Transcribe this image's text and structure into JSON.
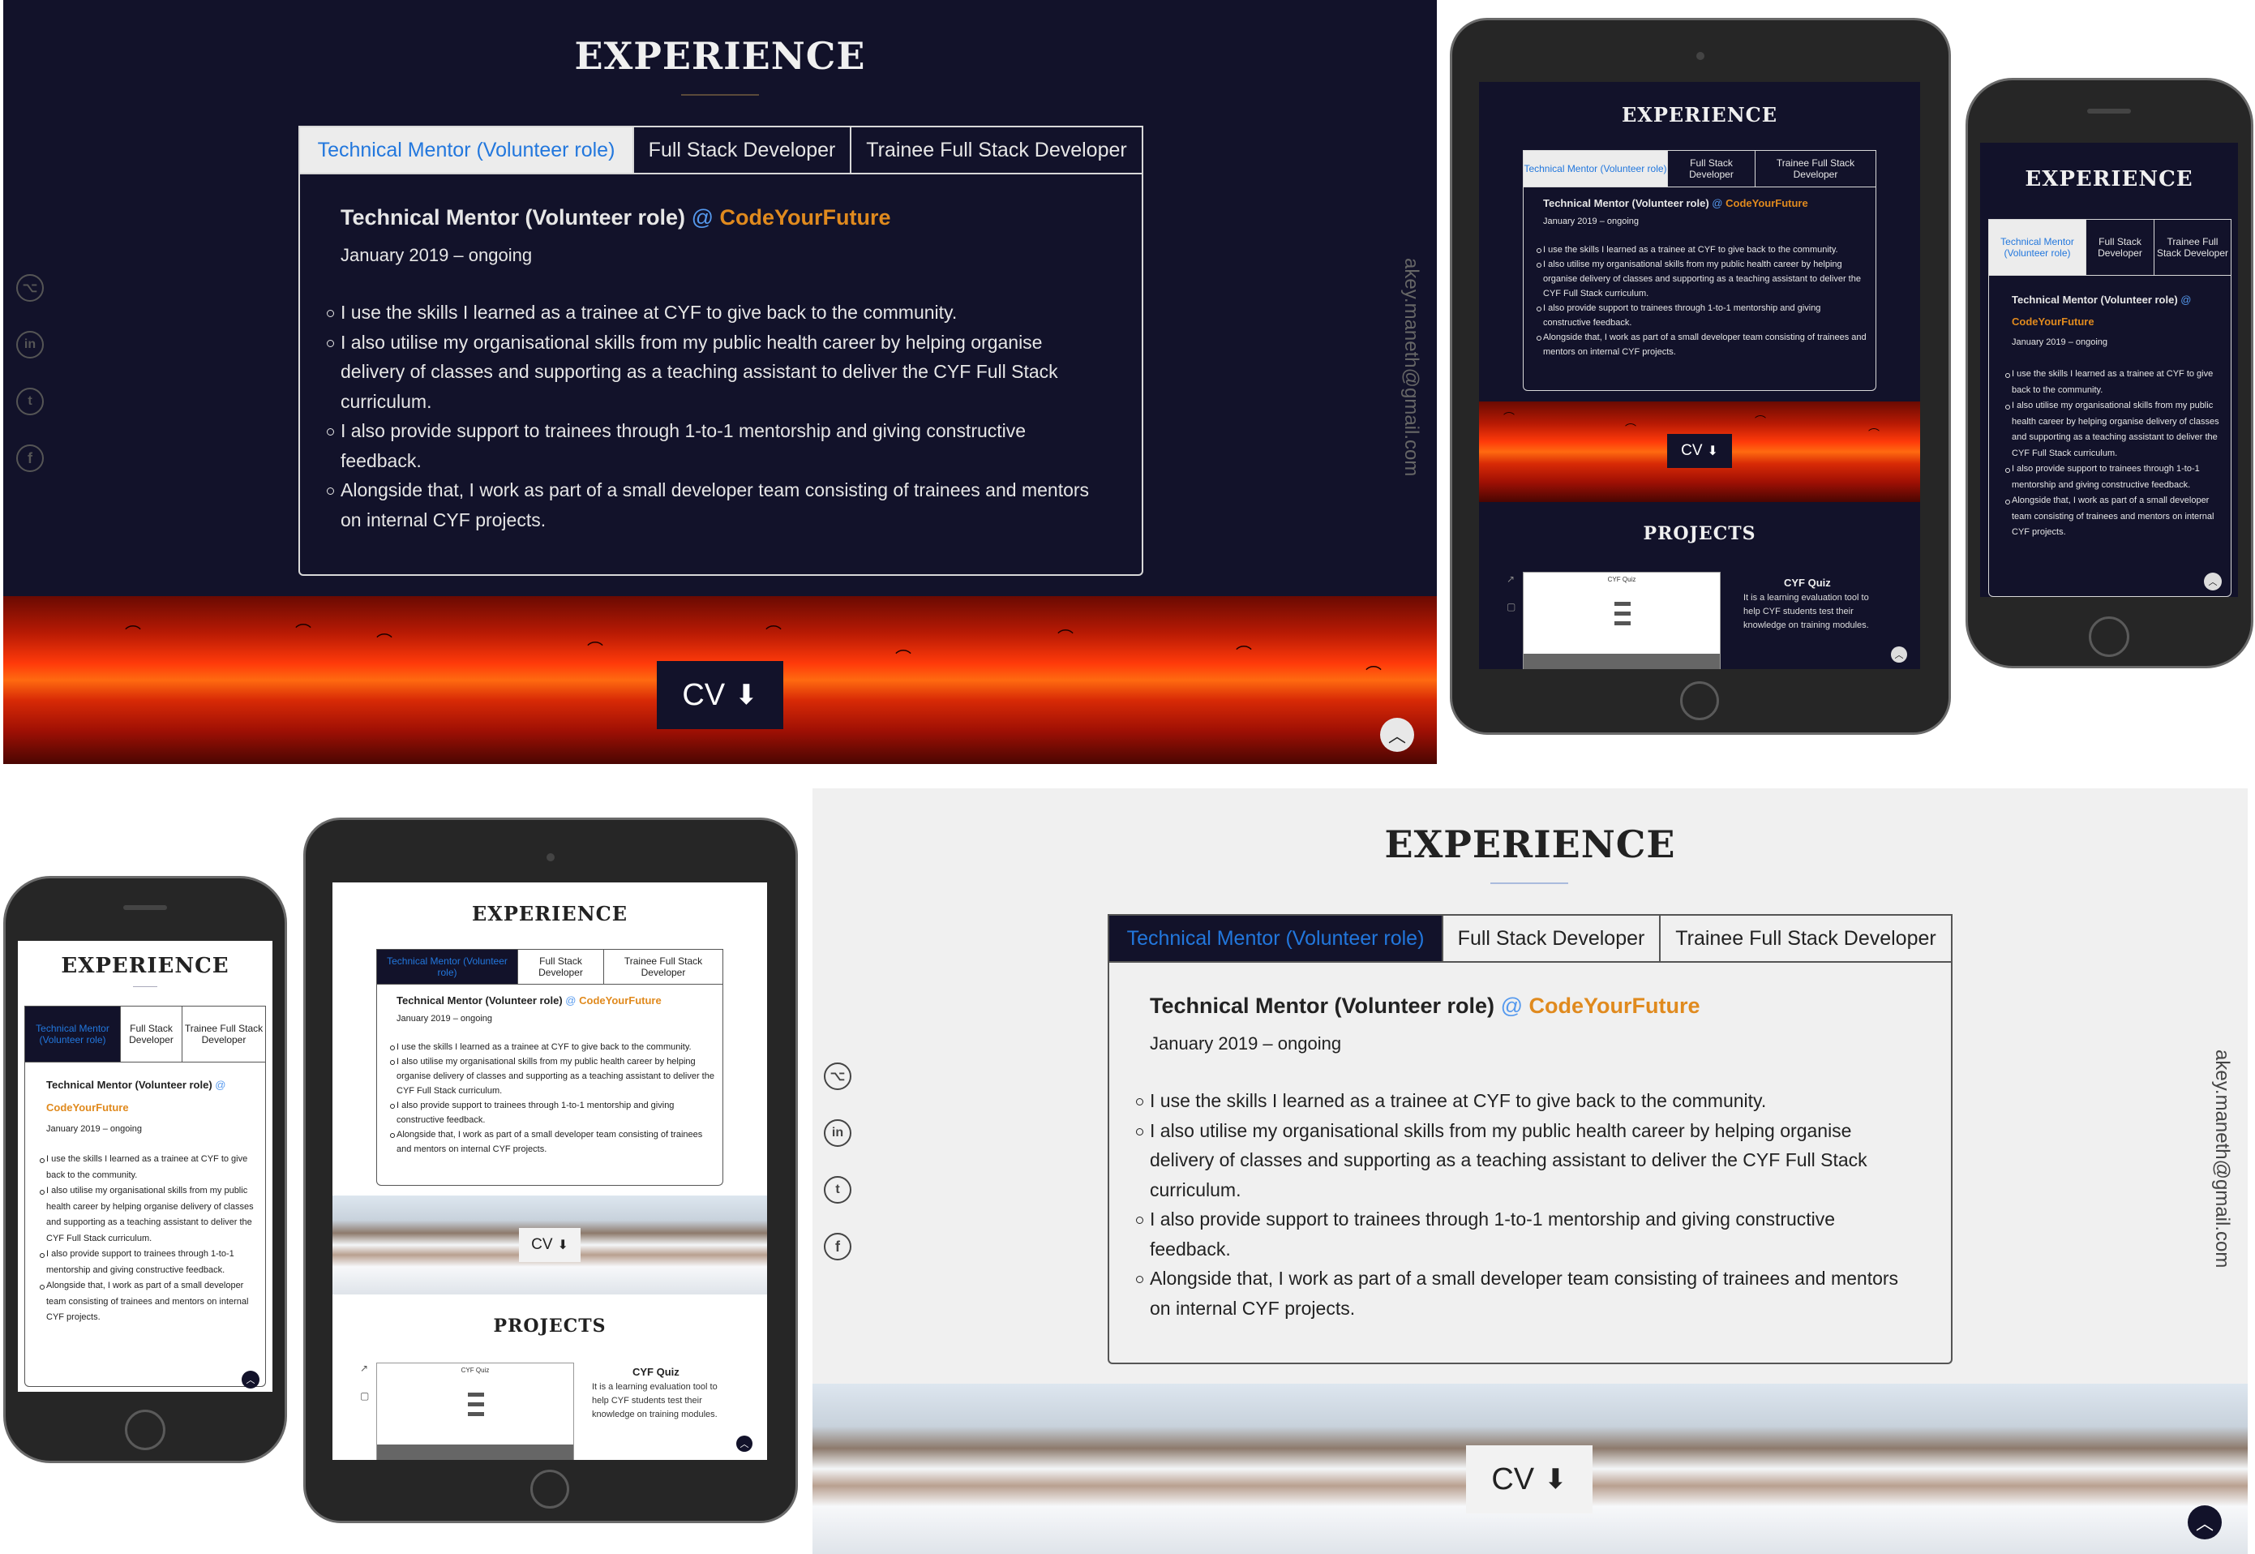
{
  "heading": "EXPERIENCE",
  "tabs": [
    "Technical Mentor (Volunteer role)",
    "Full Stack Developer",
    "Trainee Full Stack Developer"
  ],
  "job": {
    "role": "Technical Mentor (Volunteer role)",
    "at": "@",
    "company": "CodeYourFuture",
    "dates": "January 2019 – ongoing",
    "points": [
      "I use the skills I learned as a trainee at CYF to give back to the community.",
      "I also utilise my organisational skills from my public health career by helping organise delivery of classes and supporting as a teaching assistant to deliver the CYF Full Stack curriculum.",
      "I also provide support to trainees through 1-to-1 mentorship and giving constructive feedback.",
      "Alongside that, I work as part of a small developer team consisting of trainees and mentors on internal CYF projects."
    ]
  },
  "cv_label": "CV",
  "email": "akey.maneth@gmail.com",
  "projects_heading": "PROJECTS",
  "project": {
    "title": "CYF Quiz",
    "description": "It is a learning evaluation tool to help CYF students test their knowledge on training modules.",
    "screenshot_title": "CYF Quiz"
  },
  "icons": {
    "social": [
      "github-icon",
      "linkedin-icon",
      "twitter-icon",
      "facebook-icon"
    ],
    "download": "download-icon",
    "scroll_up": "chevron-up-icon",
    "external_link": "external-link-icon",
    "code": "code-icon"
  },
  "colors": {
    "dark_bg": "#12122a",
    "accent_blue": "#2277dd",
    "company_orange": "#e08a1e",
    "light_bg": "#f0f0f0"
  }
}
